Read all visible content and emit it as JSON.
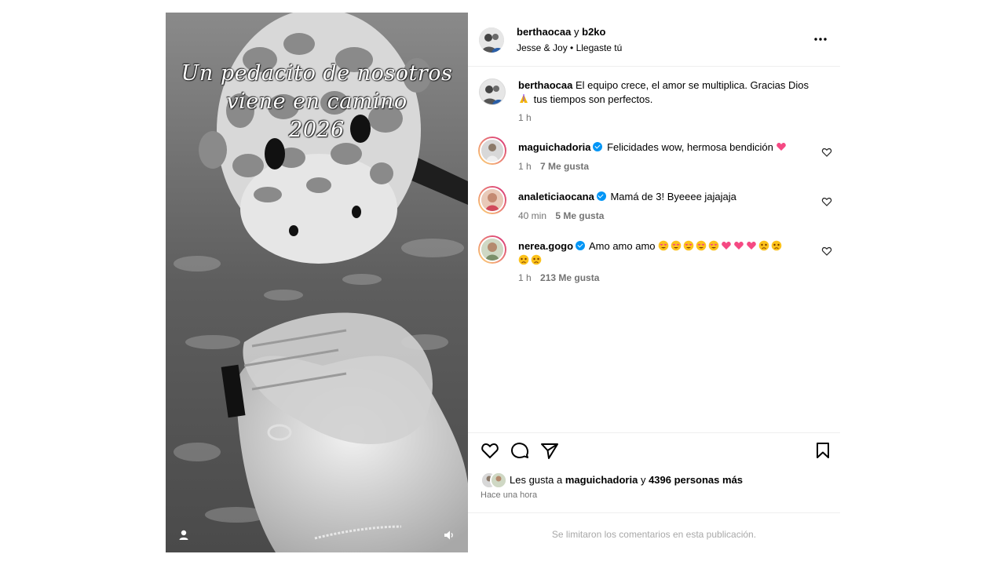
{
  "media": {
    "overlay_line1": "Un pedacito de nosotros",
    "overlay_line2": "viene en camino",
    "overlay_line3": "2026"
  },
  "post": {
    "author1": "berthaocaa",
    "joiner": "y",
    "author2": "b2ko",
    "audio": "Jesse & Joy",
    "bullet": "•",
    "location": "Llegaste tú",
    "more_icon": "more-horizontal-icon"
  },
  "caption": {
    "username": "berthaocaa",
    "text_part1": "El equipo crece, el amor se multiplica. Gracias Dios",
    "text_part2": "tus tiempos son perfectos.",
    "time": "1 h"
  },
  "comments": [
    {
      "username": "maguichadoria",
      "text": "Felicidades wow, hermosa bendición",
      "time": "1 h",
      "likes": "7 Me gusta"
    },
    {
      "username": "analeticiaocana",
      "text": "Mamá de 3! Byeeee jajajaja",
      "time": "40 min",
      "likes": "5 Me gusta"
    },
    {
      "username": "nerea.gogo",
      "text": "Amo amo amo",
      "time": "1 h",
      "likes": "213 Me gusta"
    }
  ],
  "likes_summary": {
    "prefix": "Les gusta a",
    "user": "maguichadoria",
    "middle": "y",
    "count": "4396 personas más"
  },
  "timestamp": "Hace una hora",
  "comments_limited": "Se limitaron los comentarios en esta publicación.",
  "colors": {
    "verified": "#0095f6",
    "muted": "#737373",
    "ring_gradient": [
      "#feda75",
      "#d62976"
    ]
  }
}
